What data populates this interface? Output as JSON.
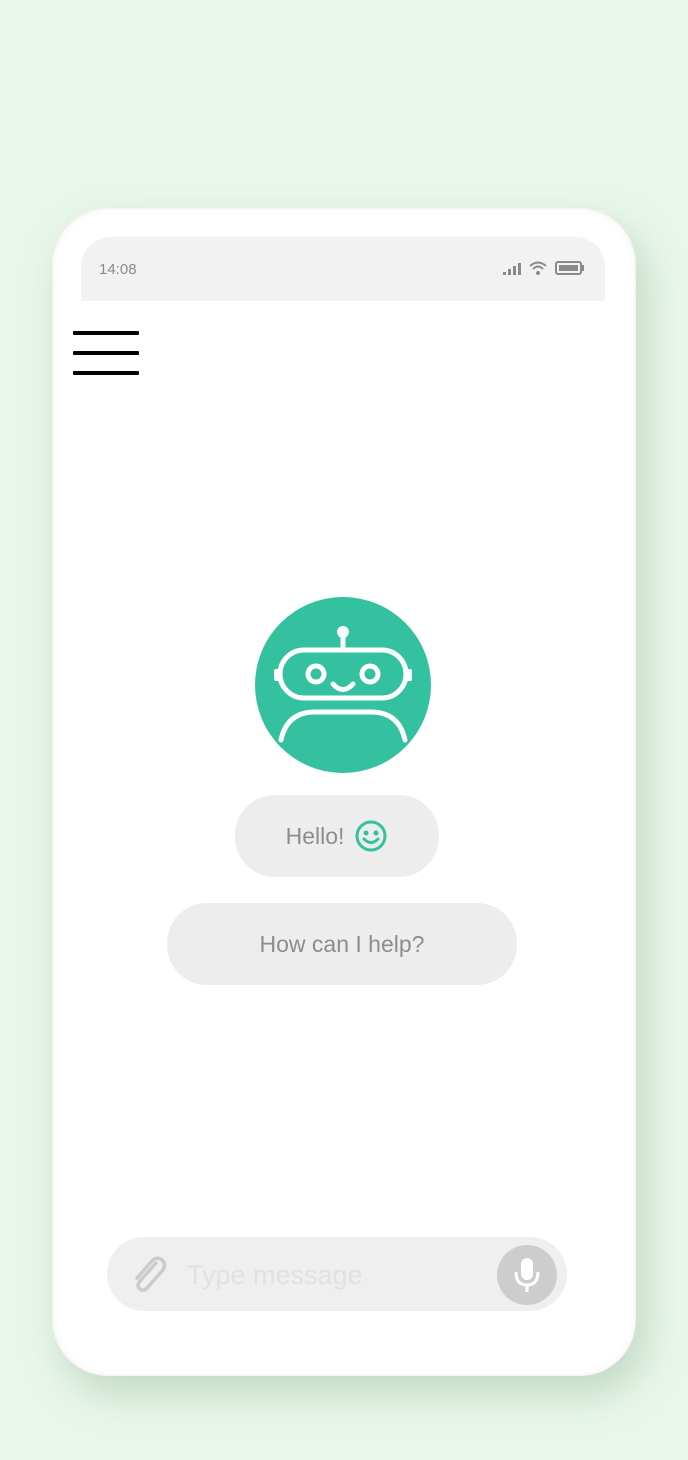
{
  "status_bar": {
    "time": "14:08",
    "icons": [
      "signal-icon",
      "wifi-icon",
      "battery-icon"
    ]
  },
  "menu": {
    "icon": "hamburger-menu-icon"
  },
  "bot": {
    "avatar_icon": "robot-icon",
    "avatar_color": "#33c1a0"
  },
  "messages": [
    {
      "text": "Hello!",
      "icon": "smiley-icon"
    },
    {
      "text": "How can I help?"
    }
  ],
  "composer": {
    "attach_icon": "paperclip-icon",
    "placeholder": "Type message",
    "value": "",
    "mic_icon": "microphone-icon"
  },
  "colors": {
    "background": "#e9f7ea",
    "accent": "#33c1a0",
    "bubble": "#ededed"
  }
}
